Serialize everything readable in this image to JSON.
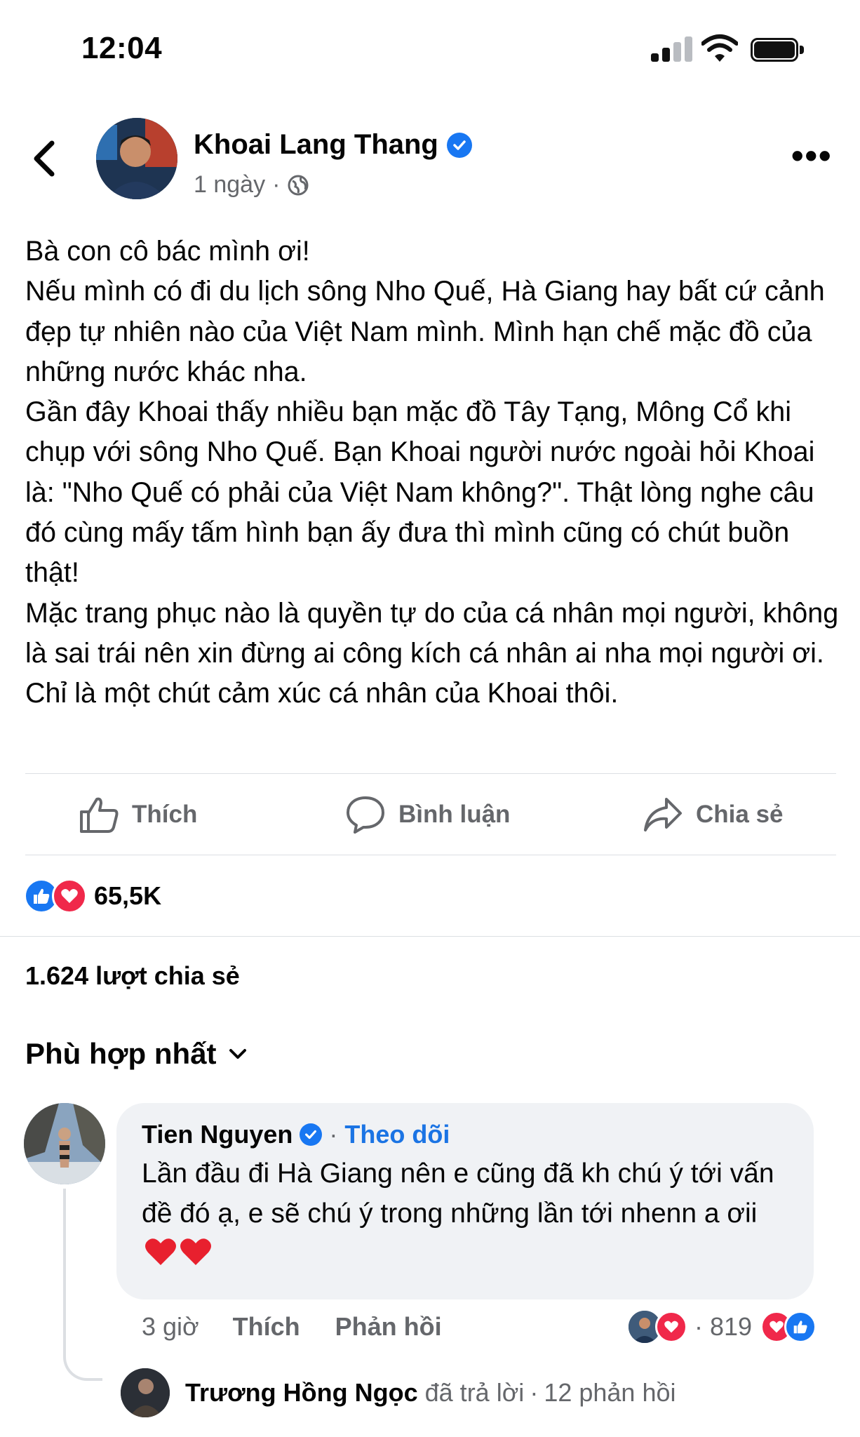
{
  "status_bar": {
    "time": "12:04"
  },
  "header": {
    "author": "Khoai Lang Thang",
    "time_ago": "1 ngày",
    "separator": "·"
  },
  "post": {
    "paragraphs": [
      "Bà con cô bác mình ơi!",
      "Nếu mình có đi du lịch sông Nho Quế, Hà Giang hay bất cứ cảnh đẹp tự nhiên nào của Việt Nam mình. Mình hạn chế mặc đồ của những nước khác nha.",
      "Gần đây Khoai thấy nhiều bạn mặc đồ Tây Tạng, Mông Cổ khi chụp với sông Nho Quế. Bạn Khoai người nước ngoài hỏi Khoai là: \"Nho Quế có phải của Việt Nam không?\". Thật lòng nghe câu đó cùng mấy tấm hình bạn ấy đưa thì mình cũng có chút buồn thật!",
      "Mặc trang phục nào là quyền tự do của cá nhân mọi người, không là sai trái nên xin đừng ai công kích cá nhân ai nha mọi người ơi. Chỉ là một chút cảm xúc cá nhân của Khoai thôi."
    ]
  },
  "actions": {
    "like": "Thích",
    "comment": "Bình luận",
    "share": "Chia sẻ"
  },
  "reactions": {
    "count": "65,5K"
  },
  "shares": {
    "text": "1.624 lượt chia sẻ"
  },
  "sort": {
    "label": "Phù hợp nhất"
  },
  "comment": {
    "author": "Tien Nguyen",
    "separator": "·",
    "follow": "Theo dõi",
    "text": "Lần đầu đi Hà Giang nên e cũng đã kh chú ý tới vấn đề đó ạ, e sẽ chú ý trong những lần tới nhenn a ơii",
    "time": "3 giờ",
    "like": "Thích",
    "reply": "Phản hồi",
    "separator2": "·",
    "reaction_count": "819"
  },
  "reply_summary": {
    "name": "Trương Hồng Ngọc",
    "action": "đã trả lời",
    "separator": "·",
    "count": "12 phản hồi"
  },
  "colors": {
    "accent": "#1877f2",
    "heart": "#f0284a",
    "muted": "#65676b"
  }
}
